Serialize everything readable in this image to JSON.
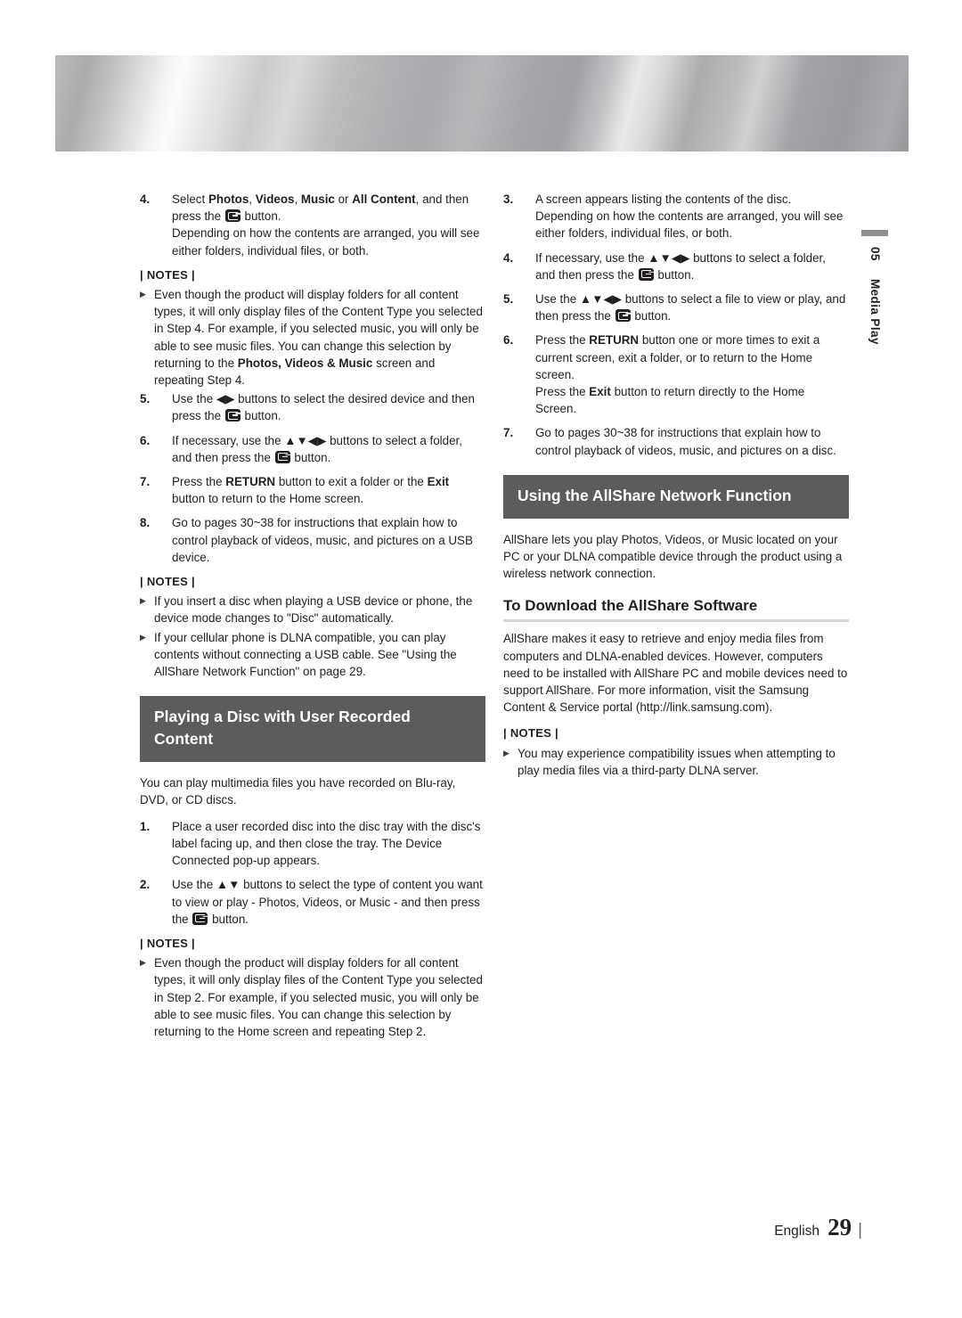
{
  "page": {
    "language_label": "English",
    "page_number": "29",
    "footer_divider": "|"
  },
  "chapter_tab": {
    "number": "05",
    "name": "Media Play"
  },
  "notes_label": "| NOTES |",
  "bullet_glyph": "▶",
  "left_column": {
    "steps": [
      {
        "num": "4.",
        "lines": [
          "Select <b>Photos</b>, <b>Videos</b>, <b>Music</b> or <b>All Content</b>, and then press the <span class=\"ent\"></span> button.",
          "Depending on how the contents are arranged, you will see either folders, individual files, or both."
        ]
      }
    ],
    "notes_1": [
      "Even though the product will display folders for all content types, it will only display files of the Content Type you selected in Step 4. For example, if you selected music, you will only be able to see music files. You can change this selection by returning to the <b>Photos, Videos &amp; Music</b> screen and repeating Step 4."
    ],
    "steps_2": [
      {
        "num": "5.",
        "text": "Use the ◀▶ buttons to select the desired device and then press the <span class=\"ent\"></span> button."
      },
      {
        "num": "6.",
        "text": "If necessary, use the ▲▼◀▶ buttons to select a folder, and then press the <span class=\"ent\"></span> button."
      },
      {
        "num": "7.",
        "text": "Press the <b>RETURN</b> button to exit a folder or the <b>Exit</b> button to return to the Home screen."
      },
      {
        "num": "8.",
        "text": "Go to pages 30~38 for instructions that explain how to control playback of videos, music, and pictures on a USB device."
      }
    ],
    "notes_2": [
      "If you insert a disc when playing a USB device or phone, the device mode changes to \"Disc\" automatically.",
      "If your cellular phone is DLNA compatible, you can play contents without connecting a USB cable. See \"Using the AllShare Network Function\" on page 29."
    ],
    "section_heading": "Playing a Disc with User Recorded Content",
    "intro": "You can play multimedia files you have recorded on Blu-ray, DVD, or CD discs.",
    "steps_3": [
      {
        "num": "1.",
        "text": "Place a user recorded disc into the disc tray with the disc's label facing up, and then close the tray. The Device Connected pop-up appears."
      },
      {
        "num": "2.",
        "text": "Use the ▲▼ buttons to select the type of content you want to view or play - Photos, Videos, or Music - and then press the <span class=\"ent\"></span> button."
      }
    ],
    "notes_3": [
      "Even though the product will display folders for all content types, it will only display files of the Content Type you selected in Step 2. For example, if you selected music, you will only be able to see music files. You can change this selection by returning to the Home screen and repeating Step 2."
    ]
  },
  "right_column": {
    "steps": [
      {
        "num": "3.",
        "text": "A screen appears listing the contents of the disc. Depending on how the contents are arranged, you will see either folders, individual files, or both."
      },
      {
        "num": "4.",
        "text": "If necessary, use the ▲▼◀▶ buttons to select a folder, and then press the <span class=\"ent\"></span> button."
      },
      {
        "num": "5.",
        "text": "Use the ▲▼◀▶ buttons to select a file to view or play, and  then press the <span class=\"ent\"></span> button."
      },
      {
        "num": "6.",
        "text": "Press the <b>RETURN</b> button one or more times to exit a current screen, exit a folder, or to return to the Home screen.<br>Press the <b>Exit</b> button to return directly to the Home Screen."
      },
      {
        "num": "7.",
        "text": "Go to pages 30~38 for instructions that explain how to control playback of videos, music, and pictures on a disc."
      }
    ],
    "section_heading": "Using the AllShare Network Function",
    "intro": "AllShare lets you play Photos, Videos, or Music located on your PC or your DLNA compatible device through the product using a wireless network connection.",
    "sub_heading": "To Download the AllShare Software",
    "body": "AllShare makes it easy to retrieve and enjoy media files from computers and DLNA-enabled devices. However, computers need to be installed with AllShare PC and mobile devices need to support AllShare. For more information, visit the Samsung Content &amp; Service portal (http://link.samsung.com).",
    "notes": [
      "You may experience compatibility issues when attempting to play media files via a third-party DLNA server."
    ]
  },
  "colors": {
    "section_bar_bg": "#5b5c5e",
    "section_bar_text": "#ffffff",
    "body_text": "#231f20",
    "rule": "#d5d6d8",
    "tab_mark": "#8c8d8f"
  }
}
